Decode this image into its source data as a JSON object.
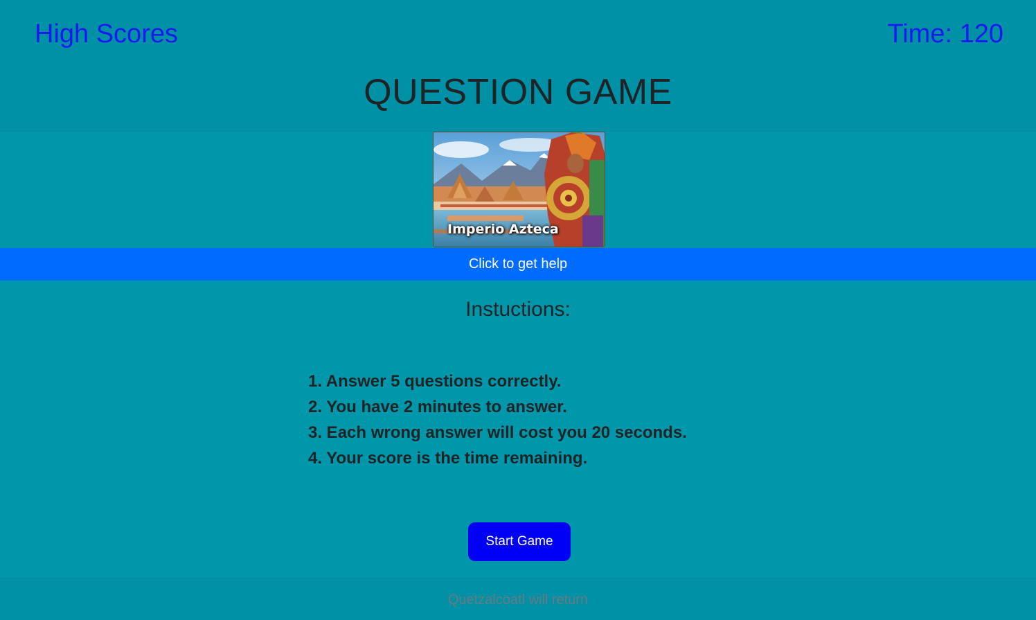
{
  "header": {
    "high_scores_label": "High Scores",
    "timer_label": "Time: 120",
    "title": "QUESTION GAME"
  },
  "hero": {
    "caption": "Imperio Azteca"
  },
  "help": {
    "label": "Click to get help"
  },
  "instructions": {
    "heading": "Instuctions:",
    "rules": [
      "1. Answer 5 questions correctly.",
      "2. You have 2 minutes to answer.",
      "3. Each wrong answer will cost you 20 seconds.",
      "4. Your score is the time remaining."
    ]
  },
  "start": {
    "label": "Start Game"
  },
  "footer": {
    "text": "Quetzalcoatl will return"
  },
  "colors": {
    "page_background": "#0097aa",
    "link": "#1a1af0",
    "help_bar": "#006cff",
    "start_button": "#0000f5"
  }
}
